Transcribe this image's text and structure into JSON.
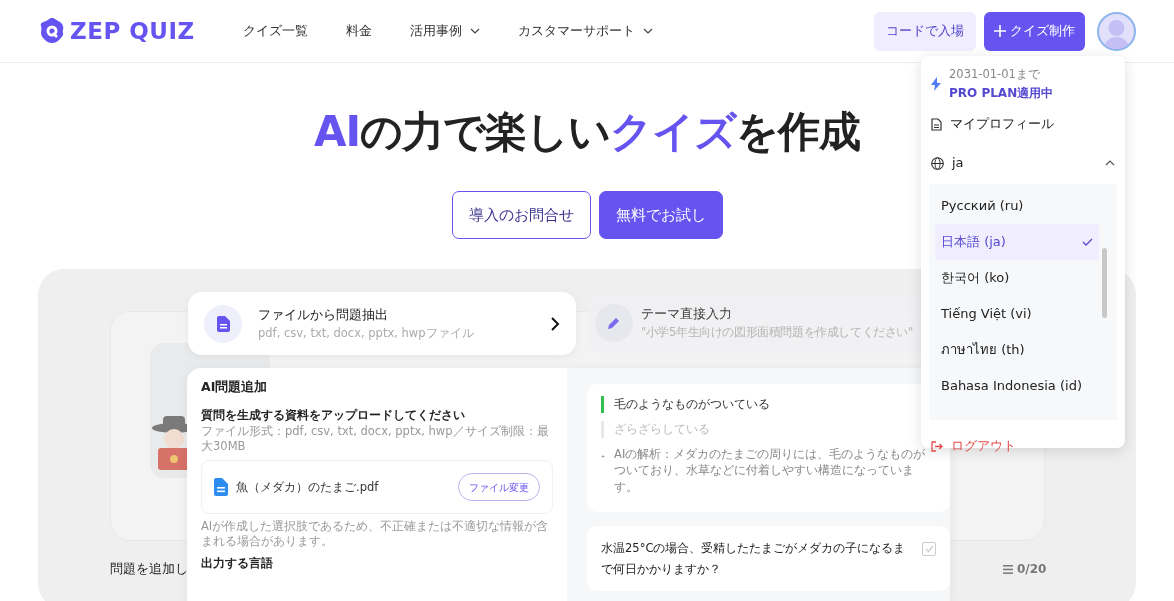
{
  "navbar": {
    "logo": "ZEP QUIZ",
    "links": [
      {
        "label": "クイズ一覧",
        "dropdown": false
      },
      {
        "label": "料金",
        "dropdown": false
      },
      {
        "label": "活用事例",
        "dropdown": true
      },
      {
        "label": "カスタマーサポート",
        "dropdown": true
      }
    ],
    "code_button": "コードで入場",
    "create_button": "クイズ制作"
  },
  "hero": {
    "title": [
      {
        "text": "AI",
        "highlight": true
      },
      {
        "text": "の力で楽しい",
        "highlight": false
      },
      {
        "text": "クイズ",
        "highlight": true
      },
      {
        "text": "を作成",
        "highlight": false
      }
    ],
    "buttons": [
      {
        "label": "導入のお問合せ",
        "kind": "outline"
      },
      {
        "label": "無料でお試し",
        "kind": "primary"
      }
    ]
  },
  "preview": {
    "file_card": {
      "title": "ファイルから問題抽出",
      "subtitle": "pdf, csv, txt, docx, pptx, hwpファイル"
    },
    "theme_card": {
      "title": "テーマ直接入力",
      "subtitle": "\"小学5年生向けの図形面積問題を作成してください\""
    },
    "ai_panel": {
      "title": "AI問題追加",
      "upload_heading": "質問を生成する資料をアップロードしてください",
      "upload_note": "ファイル形式：pdf, csv, txt, docx, pptx, hwp／サイズ制限：最大30MB",
      "file_name": "魚（メダカ）のたまご.pdf",
      "change_button": "ファイル変更",
      "disclaimer": "AIが作成した選択肢であるため、不正確または不適切な情報が含まれる場合があります。",
      "language_label": "出力する言語",
      "options": [
        {
          "text": "毛のようなものがついている",
          "correct": true
        },
        {
          "text": "ざらざらしている",
          "correct": false
        }
      ],
      "analysis": "AIの解析：メダカのたまごの周りには、毛のようなものがついており、水草などに付着しやすい構造になっています。",
      "question": {
        "text": "水温25°Cの場合、受精したたまごがメダカの子になるまで何日かかりますか？",
        "checked": false
      }
    },
    "add_label": "問題を追加し",
    "counter": "0/20"
  },
  "menu": {
    "plan_until": "2031-01-01まで",
    "plan": "PRO PLAN適用中",
    "profile": "マイプロフィール",
    "language": "ja",
    "expanded": true,
    "languages": [
      {
        "label": "Русский (ru)",
        "selected": false
      },
      {
        "label": "日本語 (ja)",
        "selected": true
      },
      {
        "label": "한국어 (ko)",
        "selected": false
      },
      {
        "label": "Tiếng Việt (vi)",
        "selected": false
      },
      {
        "label": "ภาษาไทย (th)",
        "selected": false
      },
      {
        "label": "Bahasa Indonesia (id)",
        "selected": false
      }
    ],
    "logout": "ログアウト"
  }
}
